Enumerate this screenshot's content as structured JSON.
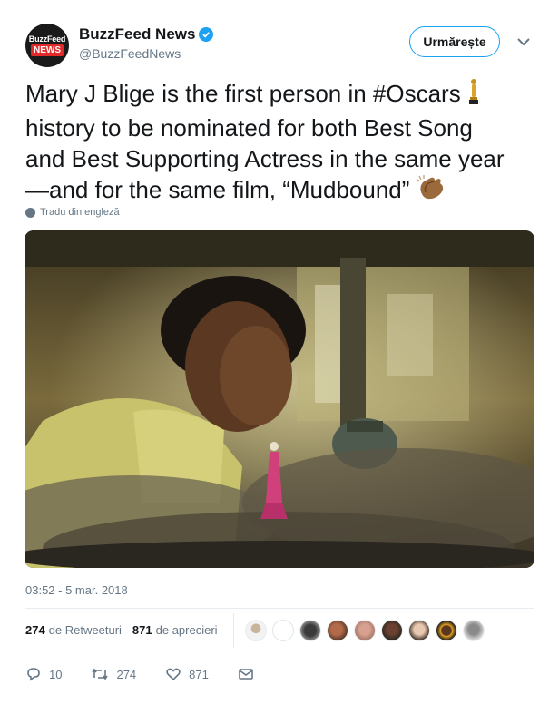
{
  "author": {
    "display_name": "BuzzFeed News",
    "handle": "@BuzzFeedNews",
    "avatar_text_top": "BuzzFeed",
    "avatar_text_bottom": "NEWS",
    "verified": true
  },
  "follow_button_label": "Urmărește",
  "tweet": {
    "text_line1": "Mary J Blige is the first person in #Oscars",
    "text_line2": "history to be nominated for both Best Song",
    "text_line3": "and Best Supporting Actress in the same year",
    "text_line4": "—and for the same film, “Mudbound”",
    "emoji_1": "oscar-trophy",
    "emoji_2": "clapping-hands",
    "translate_label": "Tradu din engleză"
  },
  "timestamp": "03:52 - 5 mar. 2018",
  "stats": {
    "retweets_count": "274",
    "retweets_label": "de Retweeturi",
    "likes_count": "871",
    "likes_label": "de aprecieri"
  },
  "actions": {
    "reply_count": "10",
    "retweet_count": "274",
    "like_count": "871"
  },
  "colors": {
    "accent": "#1da1f2",
    "text": "#14171a",
    "muted": "#657786"
  }
}
